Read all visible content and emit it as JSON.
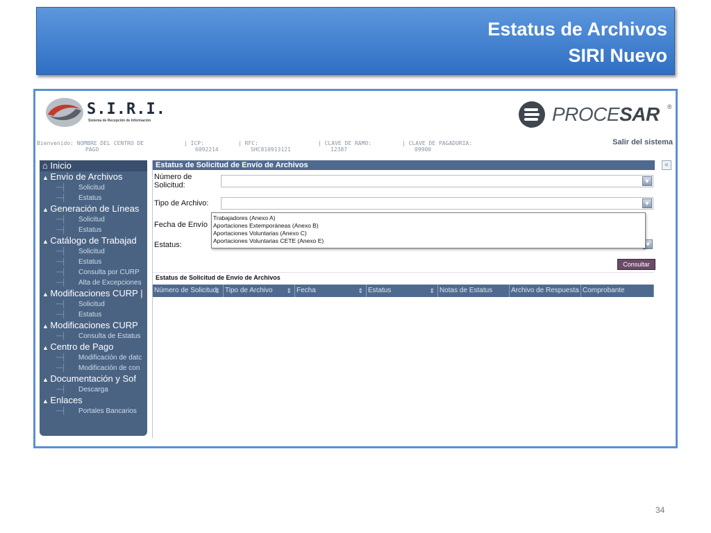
{
  "slide": {
    "title_line1": "Estatus de Archivos",
    "title_line2": "SIRI Nuevo",
    "page_number": "34"
  },
  "header": {
    "logo_title": "S.I.R.I.",
    "logo_subtitle": "Sistema de Recepción de Información",
    "brand_prefix": "PROCE",
    "brand_suffix": "SAR",
    "brand_registered": "®",
    "logout_label": "Salir del sistema",
    "info": [
      {
        "label": "Bienvenido: NOMBRE DEL CENTRO DE",
        "value": "PAGO"
      },
      {
        "label": "ICP:",
        "value": "6092214"
      },
      {
        "label": "RFC:",
        "value": "SHC810913121"
      },
      {
        "label": "CLAVE DE RAMO:",
        "value": "12387"
      },
      {
        "label": "CLAVE DE PAGADURIA:",
        "value": "09900"
      }
    ]
  },
  "sidebar": {
    "home": "Inicio",
    "sections": [
      {
        "label": "Envío de Archivos",
        "items": [
          "Solicitud",
          "Estatus"
        ]
      },
      {
        "label": "Generación de Líneas",
        "items": [
          "Solicitud",
          "Estatus"
        ]
      },
      {
        "label": "Catálogo de Trabajad",
        "items": [
          "Solicitud",
          "Estatus",
          "Consulta por CURP",
          "Alta de Excepciones"
        ]
      },
      {
        "label": "Modificaciones CURP |",
        "items": [
          "Solicitud",
          "Estatus"
        ]
      },
      {
        "label": "Modificaciones CURP",
        "items": [
          "Consulta de Estatus"
        ]
      },
      {
        "label": "Centro de Pago",
        "items": [
          "Modificación de datc",
          "Modificación de con"
        ]
      },
      {
        "label": "Documentación y Sof",
        "items": [
          "Descarga"
        ]
      },
      {
        "label": "Enlaces",
        "items": [
          "Portales Bancarios"
        ]
      }
    ]
  },
  "form": {
    "panel_title": "Estatus de Solicitud de Envío de Archivos",
    "numero_label_1": "Número de",
    "numero_label_2": "Solicitud:",
    "numero_value": "",
    "tipo_label": "Tipo de Archivo:",
    "tipo_value": "",
    "fecha_label": "Fecha de Envío",
    "estatus_label": "Estatus:",
    "tipo_options": [
      "Trabajadores (Anexo A)",
      "Aportaciones Extemporáneas (Anexo B)",
      "Aportaciones Voluntarias (Anexo C)",
      "Aportaciones Voluntarias CETE (Anexo E)"
    ],
    "consultar_label": "Consultar"
  },
  "results": {
    "title": "Estatus de Solicitud de Envío de Archivos",
    "columns": [
      {
        "label": "Número de Solicitud",
        "sortable": true
      },
      {
        "label": "Tipo de Archivo",
        "sortable": true
      },
      {
        "label": "Fecha",
        "sortable": true
      },
      {
        "label": "Estatus",
        "sortable": true
      },
      {
        "label": "Notas de Estatus",
        "sortable": false
      },
      {
        "label": "Archivo de Respuesta",
        "sortable": false
      },
      {
        "label": "Comprobante",
        "sortable": false
      }
    ]
  },
  "icons": {
    "home": "home-icon",
    "section_toggle": "triangle-up-icon",
    "dropdown": "chevron-down-icon",
    "sort": "sort-icon",
    "collapse": "double-chevron-left-icon"
  },
  "colors": {
    "banner": "#3d7fd2",
    "sidebar": "#4a6383",
    "grid_header": "#4f6a8f",
    "button": "#6a4a66"
  }
}
